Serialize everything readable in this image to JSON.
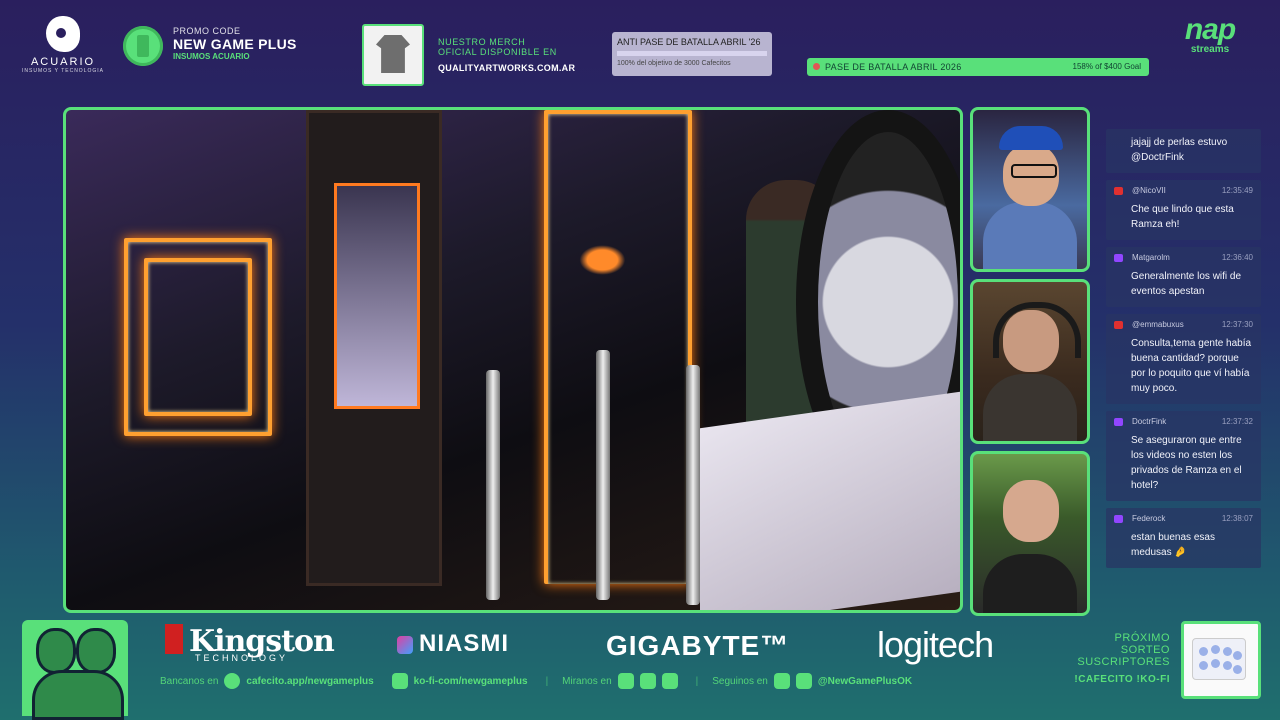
{
  "header": {
    "acuario": {
      "name": "ACUARIO",
      "sub": "INSUMOS Y TECNOLOGIA"
    },
    "promo": {
      "line1": "PROMO CODE",
      "code": "NEW GAME PLUS",
      "line3": "INSUMOS ACUARIO"
    },
    "merch": {
      "line1": "NUESTRO MERCH",
      "line2": "OFICIAL DISPONIBLE EN",
      "url": "QUALITYARTWORKS.COM.AR"
    },
    "anti_pase": {
      "title": "ANTI PASE DE BATALLA ABRIL '26",
      "status": "100% del objetivo de 3000 Cafecitos",
      "progress": 1.0
    },
    "goal": {
      "title": "PASE DE BATALLA ABRIL 2026",
      "value": "158% of $400 Goal",
      "progress": 1.0
    },
    "nap": {
      "big": "nap",
      "small": "streams"
    }
  },
  "chat": [
    {
      "platform": "",
      "user": "",
      "time": "",
      "text": "jajajj de perlas estuvo @DoctrFink"
    },
    {
      "platform": "youtube",
      "user": "@NicoVII",
      "time": "12:35:49",
      "text": "Che que lindo que esta Ramza eh!"
    },
    {
      "platform": "twitch",
      "user": "Matgarolm",
      "time": "12:36:40",
      "text": "Generalmente los wifi de eventos apestan"
    },
    {
      "platform": "youtube",
      "user": "@emmabuxus",
      "time": "12:37:30",
      "text": "Consulta,tema gente había buena cantidad? porque por lo poquito que ví había muy poco."
    },
    {
      "platform": "twitch",
      "user": "DoctrFink",
      "time": "12:37:32",
      "text": "Se aseguraron que entre los videos no esten los privados de Ramza en el hotel?"
    },
    {
      "platform": "twitch",
      "user": "Federock",
      "time": "12:38:07",
      "text": "estan buenas esas medusas 🤌"
    }
  ],
  "sponsors": {
    "kingston": "Kingston",
    "kingston_sub": "TECHNOLOGY",
    "niasmi": "NIASMI",
    "gigabyte": "GIGABYTE™",
    "logitech": "logitech"
  },
  "links": {
    "bancanos_label": "Bancanos en",
    "cafecito": "cafecito.app/newgameplus",
    "kofi": "ko-fi-com/newgameplus",
    "miranos_label": "Miranos en",
    "seguinos_label": "Seguinos en",
    "handle": "@NewGamePlusOK",
    "sep": "|"
  },
  "proximo": {
    "l1": "PRÓXIMO",
    "l2": "SORTEO",
    "l3": "SUSCRIPTORES",
    "cmd": "!CAFECITO  !KO-FI"
  },
  "colors": {
    "accent": "#59e07a",
    "youtube": "#e03030",
    "twitch": "#9146ff"
  }
}
